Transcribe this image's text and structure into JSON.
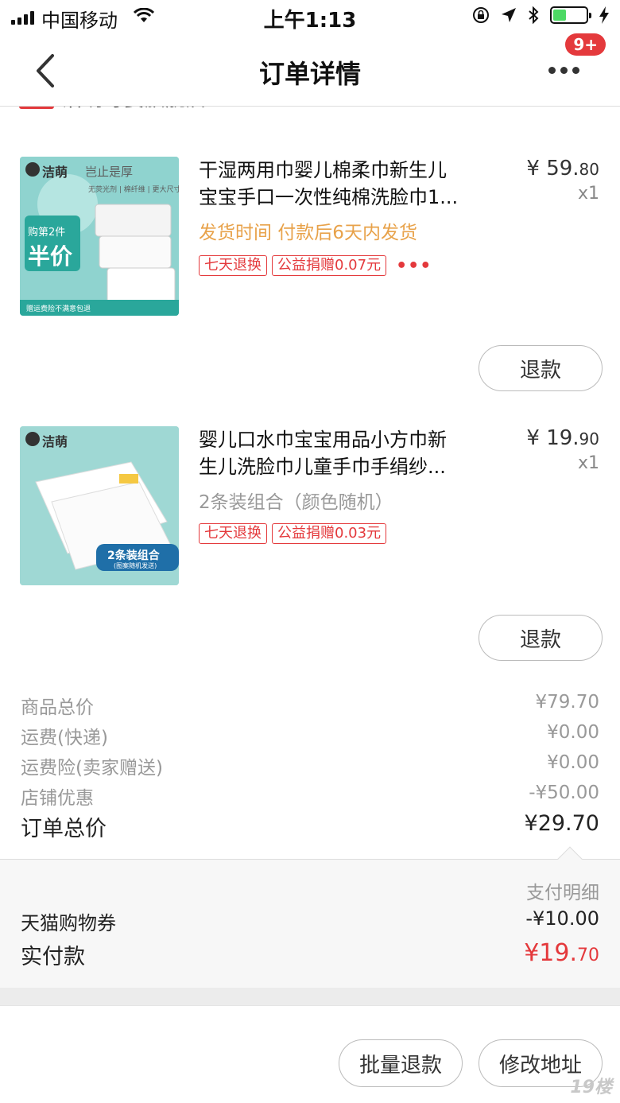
{
  "status_bar": {
    "carrier": "中国移动",
    "time": "上午1:13"
  },
  "nav": {
    "title": "订单详情",
    "badge": "9+"
  },
  "store": {
    "tag": "天猫",
    "name": "洁萌母婴旗舰店",
    "arrow": "›"
  },
  "products": [
    {
      "title_line1": "干湿两用巾婴儿棉柔巾新生儿",
      "title_line2": "宝宝手口一次性纯棉洗脸巾1...",
      "price_main": "¥ 59.",
      "price_cents": "80",
      "qty": "x1",
      "note": "发货时间 付款后6天内发货",
      "tags": [
        "七天退换",
        "公益捐赠0.07元"
      ],
      "has_more": true,
      "refund_label": "退款",
      "thumb": {
        "brand": "洁萌",
        "slogan": "岂止是厚",
        "promo_top": "购第2件",
        "promo_main": "半价",
        "banner": "无荧光剂 | 棉纤维 | 更大尺寸",
        "footer": "赠运费险不满意包退"
      }
    },
    {
      "title_line1": "婴儿口水巾宝宝用品小方巾新",
      "title_line2": "生儿洗脸巾儿童手巾手绢纱...",
      "price_main": "¥ 19.",
      "price_cents": "90",
      "qty": "x1",
      "note": "2条装组合（颜色随机）",
      "tags": [
        "七天退换",
        "公益捐赠0.03元"
      ],
      "has_more": false,
      "refund_label": "退款",
      "thumb": {
        "brand": "洁萌",
        "badge_main": "2条装组合",
        "badge_sub": "(图案随机发送)"
      }
    }
  ],
  "summary": {
    "rows": [
      {
        "label": "商品总价",
        "value": "¥79.70"
      },
      {
        "label": "运费(快递)",
        "value": "¥0.00"
      },
      {
        "label": "运费险(卖家赠送)",
        "value": "¥0.00"
      },
      {
        "label": "店铺优惠",
        "value": "-¥50.00"
      }
    ],
    "total_label": "订单总价",
    "total_value": "¥29.70"
  },
  "payment": {
    "detail_label": "支付明细",
    "coupon_label": "天猫购物券",
    "coupon_value": "-¥10.00",
    "paid_label": "实付款",
    "paid_main": "¥19.",
    "paid_cents": "70"
  },
  "bottom": {
    "batch_refund": "批量退款",
    "change_address": "修改地址",
    "watermark": "19楼"
  },
  "colors": {
    "accent": "#e4393c",
    "ship_note": "#e8a24a",
    "battery": "#4cd964",
    "thumb_bg": "#8fd3cf"
  }
}
